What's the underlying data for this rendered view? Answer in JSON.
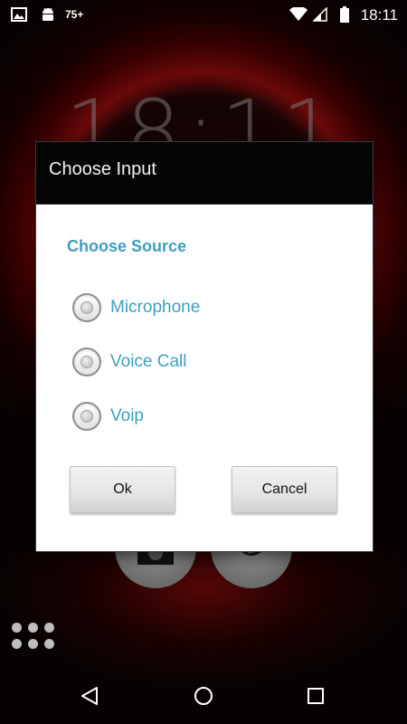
{
  "status_bar": {
    "time": "18:11",
    "notification_count": "75+",
    "icons": [
      "image-icon",
      "android-icon",
      "wifi-icon",
      "signal-icon",
      "battery-icon"
    ]
  },
  "lockscreen": {
    "clock": "18:11"
  },
  "dialog": {
    "title": "Choose Input",
    "section_title": "Choose Source",
    "options": [
      {
        "label": "Microphone",
        "selected": false
      },
      {
        "label": "Voice Call",
        "selected": false
      },
      {
        "label": "Voip",
        "selected": false
      }
    ],
    "ok_label": "Ok",
    "cancel_label": "Cancel"
  },
  "colors": {
    "accent": "#3e9fc2",
    "dialog_header": "#050505",
    "wallpaper_red": "#7a0a0a"
  },
  "nav_bar": {
    "icons": [
      "back-icon",
      "home-icon",
      "recents-icon"
    ]
  }
}
